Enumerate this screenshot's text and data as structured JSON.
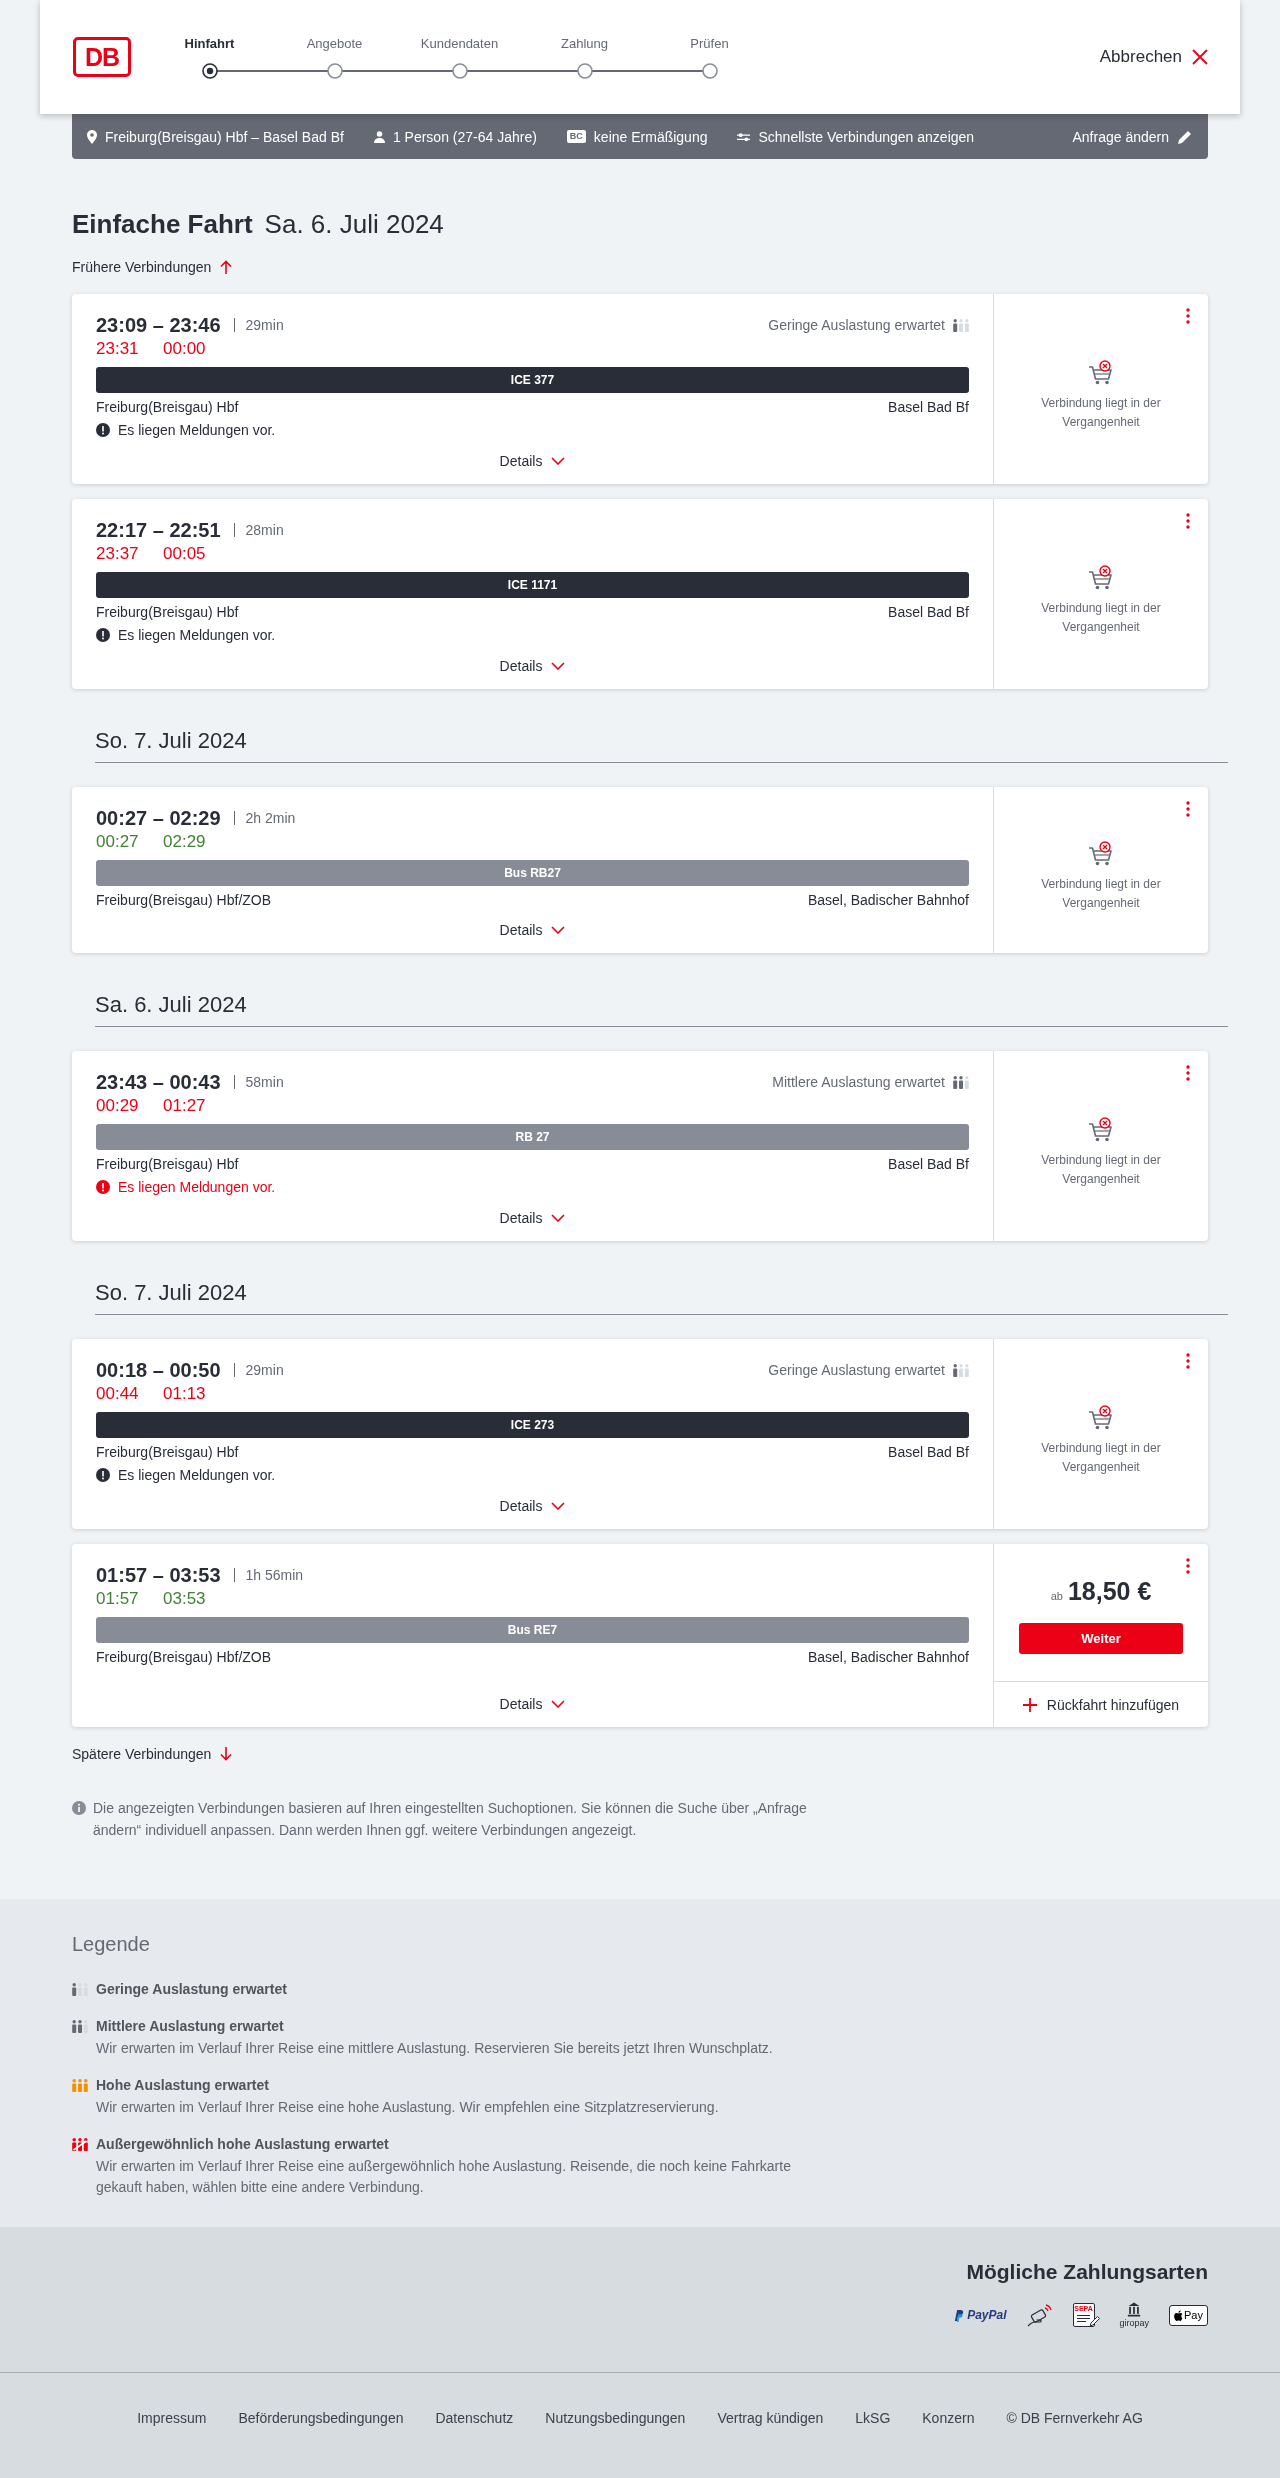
{
  "header": {
    "logo": "DB",
    "steps": [
      {
        "label": "Hinfahrt",
        "selected": true
      },
      {
        "label": "Angebote",
        "selected": false
      },
      {
        "label": "Kundendaten",
        "selected": false
      },
      {
        "label": "Zahlung",
        "selected": false
      },
      {
        "label": "Prüfen",
        "selected": false
      }
    ],
    "cancel": "Abbrechen"
  },
  "search_summary": {
    "route": "Freiburg(Breisgau) Hbf – Basel Bad Bf",
    "travelers": "1 Person (27-64 Jahre)",
    "discount_badge": "BC",
    "discount": "keine Ermäßigung",
    "filter": "Schnellste Verbindungen anzeigen",
    "edit": "Anfrage ändern"
  },
  "title": {
    "trip_type": "Einfache Fahrt",
    "date": "Sa. 6. Juli 2024"
  },
  "earlier_link": "Frühere Verbindungen",
  "results": [
    {
      "kind": "connection",
      "times": "23:09 – 23:46",
      "duration": "29min",
      "occupancy": {
        "kind": "low",
        "label": "Geringe Auslastung erwartet"
      },
      "realtime_departure": "23:31",
      "realtime_arrival": "00:00",
      "on_time": false,
      "train": {
        "kind": "long_distance",
        "label": "ICE 377"
      },
      "from": "Freiburg(Breisgau) Hbf",
      "to": "Basel Bad Bf",
      "notice": {
        "kind": "info",
        "text": "Es liegen Meldungen vor."
      },
      "details": "Details",
      "booking": {
        "kind": "past",
        "text": "Verbindung liegt in der Vergangenheit"
      }
    },
    {
      "kind": "connection",
      "times": "22:17 – 22:51",
      "duration": "28min",
      "realtime_departure": "23:37",
      "realtime_arrival": "00:05",
      "on_time": false,
      "train": {
        "kind": "long_distance",
        "label": "ICE 1171"
      },
      "from": "Freiburg(Breisgau) Hbf",
      "to": "Basel Bad Bf",
      "notice": {
        "kind": "info",
        "text": "Es liegen Meldungen vor."
      },
      "details": "Details",
      "booking": {
        "kind": "past",
        "text": "Verbindung liegt in der Vergangenheit"
      }
    },
    {
      "kind": "date",
      "text": "So. 7. Juli 2024"
    },
    {
      "kind": "connection",
      "times": "00:27 – 02:29",
      "duration": "2h 2min",
      "realtime_departure": "00:27",
      "realtime_arrival": "02:29",
      "on_time": true,
      "train": {
        "kind": "regional",
        "label": "Bus RB27"
      },
      "from": "Freiburg(Breisgau) Hbf/ZOB",
      "to": "Basel, Badischer Bahnhof",
      "details": "Details",
      "booking": {
        "kind": "past",
        "text": "Verbindung liegt in der Vergangenheit"
      }
    },
    {
      "kind": "date",
      "text": "Sa. 6. Juli 2024"
    },
    {
      "kind": "connection",
      "times": "23:43 – 00:43",
      "duration": "58min",
      "occupancy": {
        "kind": "medium",
        "label": "Mittlere Auslastung erwartet"
      },
      "realtime_departure": "00:29",
      "realtime_arrival": "01:27",
      "on_time": false,
      "train": {
        "kind": "regional",
        "label": "RB 27"
      },
      "from": "Freiburg(Breisgau) Hbf",
      "to": "Basel Bad Bf",
      "notice": {
        "kind": "warning",
        "text": "Es liegen Meldungen vor."
      },
      "details": "Details",
      "booking": {
        "kind": "past",
        "text": "Verbindung liegt in der Vergangenheit"
      }
    },
    {
      "kind": "date",
      "text": "So. 7. Juli 2024"
    },
    {
      "kind": "connection",
      "times": "00:18 – 00:50",
      "duration": "29min",
      "occupancy": {
        "kind": "low",
        "label": "Geringe Auslastung erwartet"
      },
      "realtime_departure": "00:44",
      "realtime_arrival": "01:13",
      "on_time": false,
      "train": {
        "kind": "long_distance",
        "label": "ICE 273"
      },
      "from": "Freiburg(Breisgau) Hbf",
      "to": "Basel Bad Bf",
      "notice": {
        "kind": "info",
        "text": "Es liegen Meldungen vor."
      },
      "details": "Details",
      "booking": {
        "kind": "past",
        "text": "Verbindung liegt in der Vergangenheit"
      }
    },
    {
      "kind": "connection",
      "times": "01:57 – 03:53",
      "duration": "1h 56min",
      "realtime_departure": "01:57",
      "realtime_arrival": "03:53",
      "on_time": true,
      "train": {
        "kind": "regional",
        "label": "Bus RE7"
      },
      "from": "Freiburg(Breisgau) Hbf/ZOB",
      "to": "Basel, Badischer Bahnhof",
      "details": "Details",
      "booking": {
        "kind": "offer",
        "price_prefix": "ab",
        "price": "18,50 €",
        "button": "Weiter",
        "return_trip": "Rückfahrt hinzufügen"
      }
    }
  ],
  "later_link": "Spätere Verbindungen",
  "info_note": "Die angezeigten Verbindungen basieren auf Ihren eingestellten Suchoptionen. Sie können die Suche über „Anfrage ändern“ individuell anpassen. Dann werden Ihnen ggf. weitere Verbindungen angezeigt.",
  "legend": {
    "title": "Legende",
    "items": [
      {
        "kind": "low",
        "title": "Geringe Auslastung erwartet"
      },
      {
        "kind": "medium",
        "title": "Mittlere Auslastung erwartet",
        "description": "Wir erwarten im Verlauf Ihrer Reise eine mittlere Auslastung. Reservieren Sie bereits jetzt Ihren Wunschplatz."
      },
      {
        "kind": "high",
        "title": "Hohe Auslastung erwartet",
        "description": "Wir erwarten im Verlauf Ihrer Reise eine hohe Auslastung. Wir empfehlen eine Sitzplatzreservierung."
      },
      {
        "kind": "exceptional",
        "title": "Außergewöhnlich hohe Auslastung erwartet",
        "description": "Wir erwarten im Verlauf Ihrer Reise eine außergewöhnlich hohe Auslastung. Reisende, die noch keine Fahrkarte gekauft haben, wählen bitte eine andere Verbindung."
      }
    ]
  },
  "payment": {
    "title": "Mögliche Zahlungsarten",
    "methods": [
      {
        "kind": "paypal",
        "label": "PayPal"
      },
      {
        "kind": "contactless"
      },
      {
        "kind": "sepa",
        "label": "SEPA"
      },
      {
        "kind": "giropay",
        "label": "giropay"
      },
      {
        "kind": "apple_pay",
        "label": "Pay"
      }
    ]
  },
  "footer": {
    "links": [
      "Impressum",
      "Beförderungsbedingungen",
      "Datenschutz",
      "Nutzungsbedingungen",
      "Vertrag kündigen",
      "LkSG",
      "Konzern"
    ],
    "copyright": "© DB Fernverkehr AG"
  }
}
